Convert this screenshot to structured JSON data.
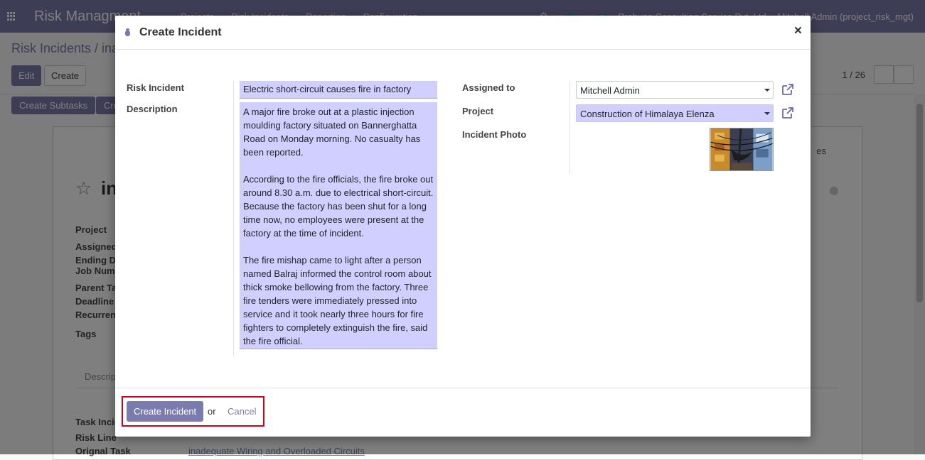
{
  "app": {
    "title": "Risk Managment",
    "menu": [
      "Projects",
      "Risk Incidents",
      "Reporting",
      "Configuration"
    ],
    "activity_count": "4",
    "message_count": "5",
    "company": "Probuse Consulting Service Pvt. Ltd",
    "user": "Mitchell Admin (project_risk_mgt)"
  },
  "background": {
    "breadcrumb": "Risk Incidents / ina",
    "edit_label": "Edit",
    "create_label": "Create",
    "pager": "1 / 26",
    "subtasks_label": "Create Subtasks",
    "other_btn_label": "Cre",
    "record_title": "in",
    "labels": [
      "Project",
      "Assigned",
      "Ending D",
      "Job Num",
      "Parent Ta",
      "Deadline",
      "Recurren",
      "Tags"
    ],
    "tab_label": "Descrip",
    "lower_labels": [
      "Task Incid",
      "Risk Line",
      "Orignal Task"
    ],
    "original_task_link": "inadequate Wiring and Overloaded Circuits",
    "right_tab_fragment": "es"
  },
  "dialog": {
    "title": "Create Incident",
    "labels": {
      "risk_incident": "Risk Incident",
      "description": "Description",
      "assigned_to": "Assigned to",
      "project": "Project",
      "incident_photo": "Incident Photo"
    },
    "risk_incident_value": "Electric short-circuit causes fire in factory",
    "description_paragraphs": [
      "A major fire broke out at a plastic injection moulding factory situated on Bannerghatta Road on Monday morning. No casualty has been reported.",
      "According to the fire officials, the fire broke out around 8.30 a.m. due to electrical short-circuit. Because the factory has been shut for a long time now, no employees were present at the factory at the time of incident.",
      "The fire mishap came to light after a person named Balraj informed the control room about thick smoke bellowing from the factory. Three fire tenders were immediately pressed into service and it took nearly three hours for fire fighters to completely extinguish the fire, said the fire official."
    ],
    "assigned_to_value": "Mitchell Admin",
    "project_value": "Construction of Himalaya Elenza",
    "create_button": "Create Incident",
    "or_text": "or",
    "cancel_link": "Cancel",
    "close_symbol": "×"
  },
  "colors": {
    "brand": "#7c7bad",
    "required_field": "#d0cfff",
    "highlight_border": "#d0021b"
  }
}
